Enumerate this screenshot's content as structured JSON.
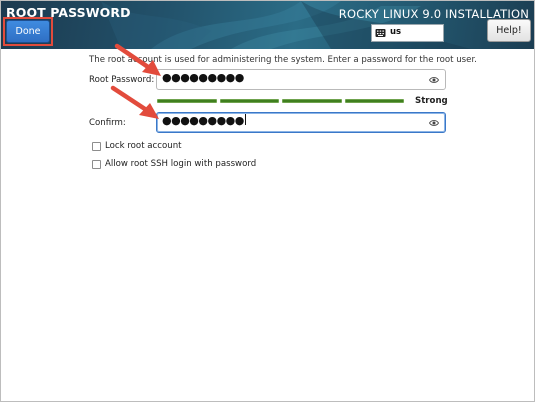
{
  "header": {
    "page_title": "ROOT PASSWORD",
    "done_label": "Done",
    "install_title": "ROCKY LINUX 9.0 INSTALLATION",
    "keyboard_layout": "us",
    "help_label": "Help!"
  },
  "form": {
    "description": "The root account is used for administering the system.  Enter a password for the root user.",
    "root_password_label": "Root Password:",
    "root_password_masked": "●●●●●●●●●",
    "confirm_label": "Confirm:",
    "confirm_masked": "●●●●●●●●●",
    "strength": {
      "label": "Strong",
      "level": 1.0,
      "color": "#3f7f1e"
    },
    "checkboxes": [
      {
        "label": "Lock root account",
        "checked": false
      },
      {
        "label": "Allow root SSH login with password",
        "checked": false
      }
    ]
  },
  "colors": {
    "annotation_red": "#e24b3c",
    "accent_blue": "#2f6fc4",
    "focus_blue": "#3a78c8"
  },
  "icons": [
    "keyboard-icon",
    "eye-icon",
    "arrow-annotation"
  ]
}
